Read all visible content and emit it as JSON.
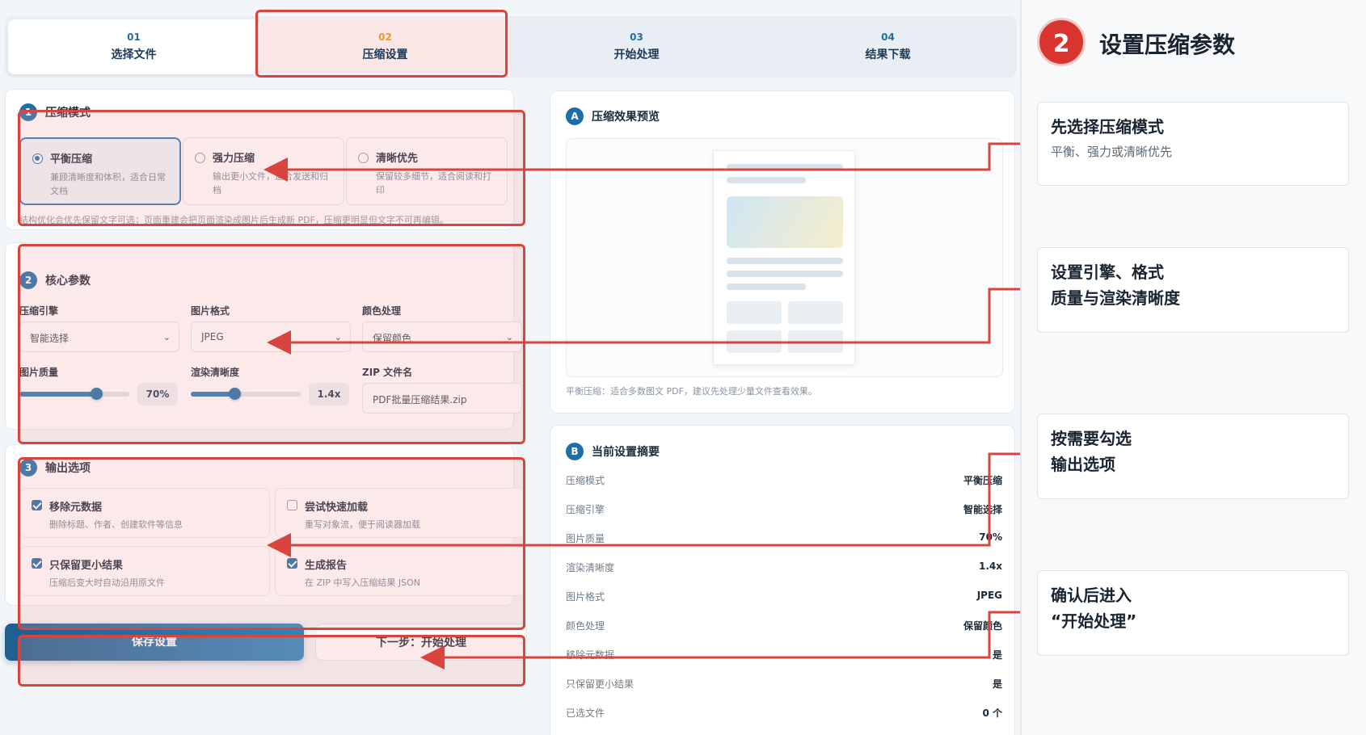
{
  "stepper": [
    {
      "num": "01",
      "label": "选择文件"
    },
    {
      "num": "02",
      "label": "压缩设置"
    },
    {
      "num": "03",
      "label": "开始处理"
    },
    {
      "num": "04",
      "label": "结果下载"
    }
  ],
  "mode_section": {
    "badge": "1",
    "title": "压缩模式",
    "modes": [
      {
        "title": "平衡压缩",
        "desc": "兼顾清晰度和体积，适合日常文档",
        "selected": true
      },
      {
        "title": "强力压缩",
        "desc": "输出更小文件，适合发送和归档",
        "selected": false
      },
      {
        "title": "清晰优先",
        "desc": "保留较多细节，适合阅读和打印",
        "selected": false
      }
    ],
    "hint": "结构优化会优先保留文字可选；页面重建会把页面渲染成图片后生成新 PDF，压缩更明显但文字不可再编辑。"
  },
  "core_section": {
    "badge": "2",
    "title": "核心参数",
    "engine_label": "压缩引擎",
    "engine_value": "智能选择",
    "format_label": "图片格式",
    "format_value": "JPEG",
    "color_label": "颜色处理",
    "color_value": "保留颜色",
    "quality_label": "图片质量",
    "quality_value": "70%",
    "quality_fraction": 0.7,
    "render_label": "渲染清晰度",
    "render_value": "1.4x",
    "render_fraction": 0.4,
    "zip_label": "ZIP 文件名",
    "zip_value": "PDF批量压缩结果.zip"
  },
  "output_section": {
    "badge": "3",
    "title": "输出选项",
    "options": [
      {
        "title": "移除元数据",
        "desc": "删除标题、作者、创建软件等信息",
        "checked": true
      },
      {
        "title": "尝试快速加载",
        "desc": "重写对象流，便于阅读器加载",
        "checked": false
      },
      {
        "title": "只保留更小结果",
        "desc": "压缩后变大时自动沿用原文件",
        "checked": true
      },
      {
        "title": "生成报告",
        "desc": "在 ZIP 中写入压缩结果 JSON",
        "checked": true
      }
    ]
  },
  "buttons": {
    "save": "保存设置",
    "next": "下一步：开始处理"
  },
  "preview": {
    "badge": "A",
    "title": "压缩效果预览",
    "caption": "平衡压缩：适合多数图文 PDF，建议先处理少量文件查看效果。"
  },
  "summary": {
    "badge": "B",
    "title": "当前设置摘要",
    "rows": [
      {
        "k": "压缩模式",
        "v": "平衡压缩"
      },
      {
        "k": "压缩引擎",
        "v": "智能选择"
      },
      {
        "k": "图片质量",
        "v": "70%"
      },
      {
        "k": "渲染清晰度",
        "v": "1.4x"
      },
      {
        "k": "图片格式",
        "v": "JPEG"
      },
      {
        "k": "颜色处理",
        "v": "保留颜色"
      },
      {
        "k": "移除元数据",
        "v": "是"
      },
      {
        "k": "只保留更小结果",
        "v": "是"
      },
      {
        "k": "已选文件",
        "v": "0 个"
      }
    ]
  },
  "sidebar": {
    "badge": "2",
    "title": "设置压缩参数",
    "notes": [
      {
        "line1": "先选择压缩模式",
        "line2": "平衡、强力或清晰优先"
      },
      {
        "line1": "设置引擎、格式",
        "line2": "质量与渲染清晰度"
      },
      {
        "line1": "按需要勾选",
        "line2": "输出选项"
      },
      {
        "line1": "确认后进入",
        "line2": "“开始处理”"
      }
    ]
  },
  "colors": {
    "accent": "#1e6fa8",
    "highlight": "#d9443f"
  }
}
